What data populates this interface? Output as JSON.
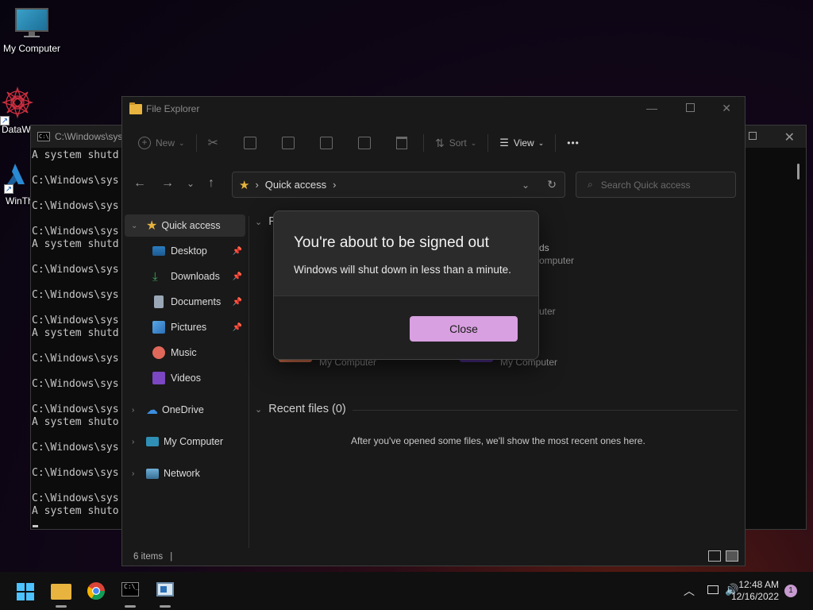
{
  "desktop": {
    "icons": [
      {
        "label": "My Computer"
      },
      {
        "label": "DataW"
      },
      {
        "label": "WinTh"
      }
    ]
  },
  "console": {
    "title": "C:\\Windows\\sys",
    "lines": "A system shutd\n\nC:\\Windows\\sys\n\nC:\\Windows\\sys\n\nC:\\Windows\\sys\nA system shutd\n\nC:\\Windows\\sys\n\nC:\\Windows\\sys\n\nC:\\Windows\\sys\nA system shutd\n\nC:\\Windows\\sys\n\nC:\\Windows\\sys\n\nC:\\Windows\\sys\nA system shuto\n\nC:\\Windows\\sys\n\nC:\\Windows\\sys\n\nC:\\Windows\\sys\nA system shuto"
  },
  "explorer": {
    "title": "File Explorer",
    "toolbar": {
      "new_label": "New",
      "sort_label": "Sort",
      "view_label": "View",
      "more_label": "•••"
    },
    "address": {
      "location": "Quick access"
    },
    "search": {
      "placeholder": "Search Quick access"
    },
    "nav": {
      "quick_access": "Quick access",
      "desktop": "Desktop",
      "downloads": "Downloads",
      "documents": "Documents",
      "pictures": "Pictures",
      "music": "Music",
      "videos": "Videos",
      "onedrive": "OneDrive",
      "my_computer": "My Computer",
      "network": "Network"
    },
    "folders_section": {
      "header_partial": "Fo",
      "tiles": [
        {
          "name_partial": "ds",
          "location_partial": "omputer"
        },
        {
          "location_partial": "uter"
        },
        {
          "location": "My Computer"
        },
        {
          "location": "My Computer"
        }
      ]
    },
    "recent_section": {
      "header": "Recent files (0)",
      "empty_message": "After you've opened some files, we'll show the most recent ones here."
    },
    "status": {
      "items": "6 items",
      "separator": "|"
    }
  },
  "dialog": {
    "title": "You're about to be signed out",
    "message": "Windows will shut down in less than a minute.",
    "close_label": "Close"
  },
  "taskbar": {
    "clock_time": "12:48 AM",
    "clock_date": "12/16/2022",
    "notification_count": "1"
  },
  "colors": {
    "accent": "#d8a0e0",
    "folder": "#e8b33e",
    "star": "#e8b33e"
  }
}
